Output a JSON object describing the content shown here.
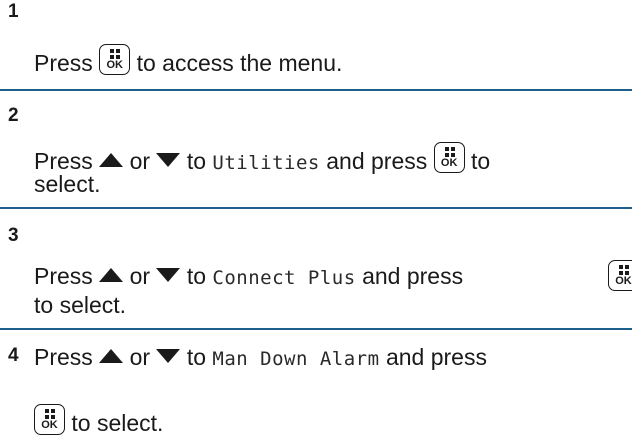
{
  "steps": [
    {
      "number": "1",
      "line1": {
        "press": "Press",
        "after_key": "to access the menu."
      }
    },
    {
      "number": "2",
      "line1": {
        "press": "Press",
        "or": "or",
        "to": "to",
        "target": "Utilities",
        "and_press": "and press",
        "end": "to"
      },
      "line2": "select."
    },
    {
      "number": "3",
      "line1": {
        "press": "Press",
        "or": "or",
        "to": "to",
        "target": "Connect Plus",
        "and_press": "and press"
      },
      "line2": "to select."
    },
    {
      "number": "4",
      "line1": {
        "press": "Press",
        "or": "or",
        "to": "to",
        "target": "Man Down Alarm",
        "and_press": "and press"
      },
      "line2": {
        "after_key": "to select."
      }
    }
  ],
  "key": {
    "ok_label": "OK"
  },
  "icons": {
    "up": "up-arrow-icon",
    "down": "down-arrow-icon",
    "menu_ok": "menu-ok-key-icon"
  },
  "colors": {
    "divider": "#1f5f8b",
    "text": "#1a1a1a"
  }
}
